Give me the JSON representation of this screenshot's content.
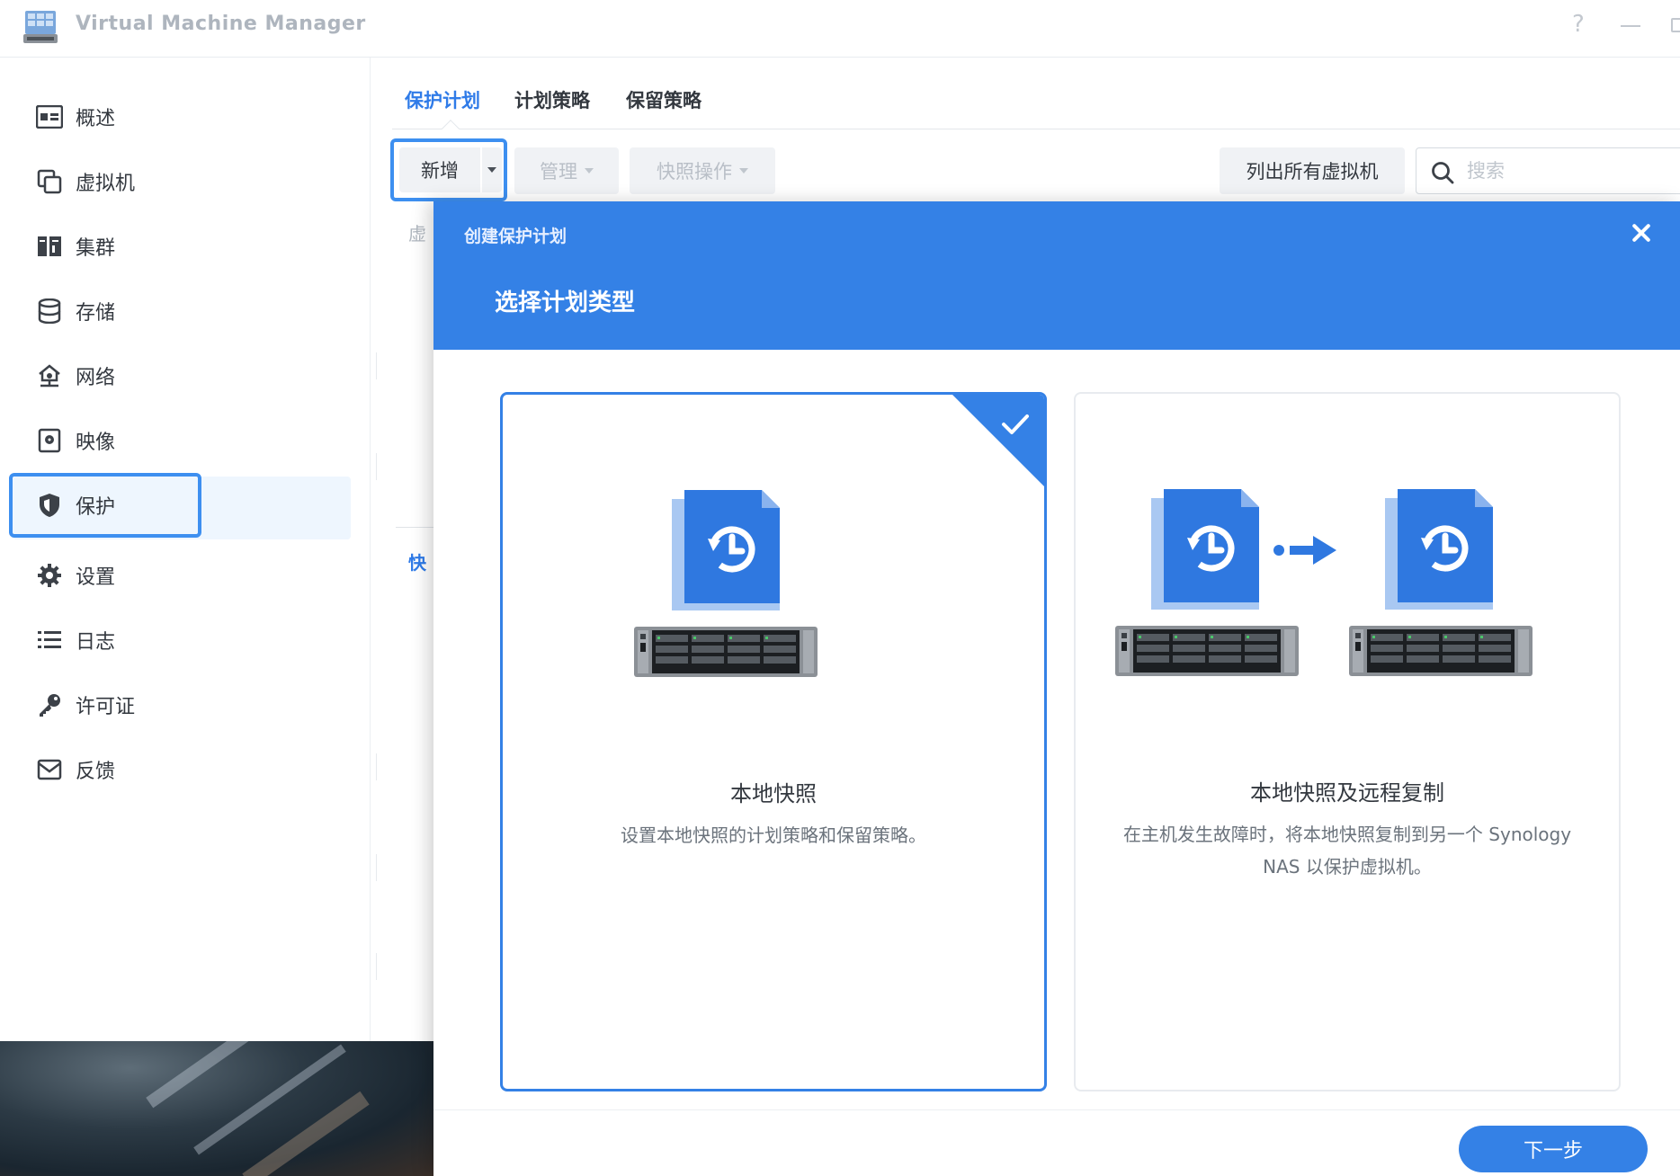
{
  "titlebar": {
    "app_title": "Virtual Machine Manager",
    "help_icon": "?",
    "icons": [
      "vmm-app-icon",
      "help-icon",
      "minimize-icon",
      "maximize-icon"
    ]
  },
  "sidebar": {
    "items": [
      {
        "label": "概述",
        "icon": "overview-icon"
      },
      {
        "label": "虚拟机",
        "icon": "virtual-machine-icon"
      },
      {
        "label": "集群",
        "icon": "cluster-icon"
      },
      {
        "label": "存储",
        "icon": "storage-icon"
      },
      {
        "label": "网络",
        "icon": "network-icon"
      },
      {
        "label": "映像",
        "icon": "image-icon"
      },
      {
        "label": "保护",
        "icon": "shield-icon",
        "active": true
      },
      {
        "label": "设置",
        "icon": "gear-icon"
      },
      {
        "label": "日志",
        "icon": "list-icon"
      },
      {
        "label": "许可证",
        "icon": "key-icon"
      },
      {
        "label": "反馈",
        "icon": "mail-icon"
      }
    ]
  },
  "main": {
    "tabs": [
      {
        "label": "保护计划",
        "active": true
      },
      {
        "label": "计划策略"
      },
      {
        "label": "保留策略"
      }
    ],
    "toolbar": {
      "add_label": "新增",
      "manage_label": "管理",
      "snapshot_ops_label": "快照操作",
      "list_all_vms_label": "列出所有虚拟机",
      "search_placeholder": "搜索"
    },
    "background_fragments": {
      "col_header": "虚",
      "section_label": "快"
    }
  },
  "dialog": {
    "header_title": "创建保护计划",
    "step_title": "选择计划类型",
    "options": [
      {
        "title": "本地快照",
        "description": "设置本地快照的计划策略和保留策略。",
        "selected": true
      },
      {
        "title": "本地快照及远程复制",
        "description": "在主机发生故障时，将本地快照复制到另一个 Synology NAS 以保护虚拟机。",
        "selected": false
      }
    ],
    "next_label": "下一步"
  },
  "colors": {
    "accent": "#3481e6",
    "highlight_border": "#3d8ff0",
    "active_tab": "#2f7be8"
  }
}
